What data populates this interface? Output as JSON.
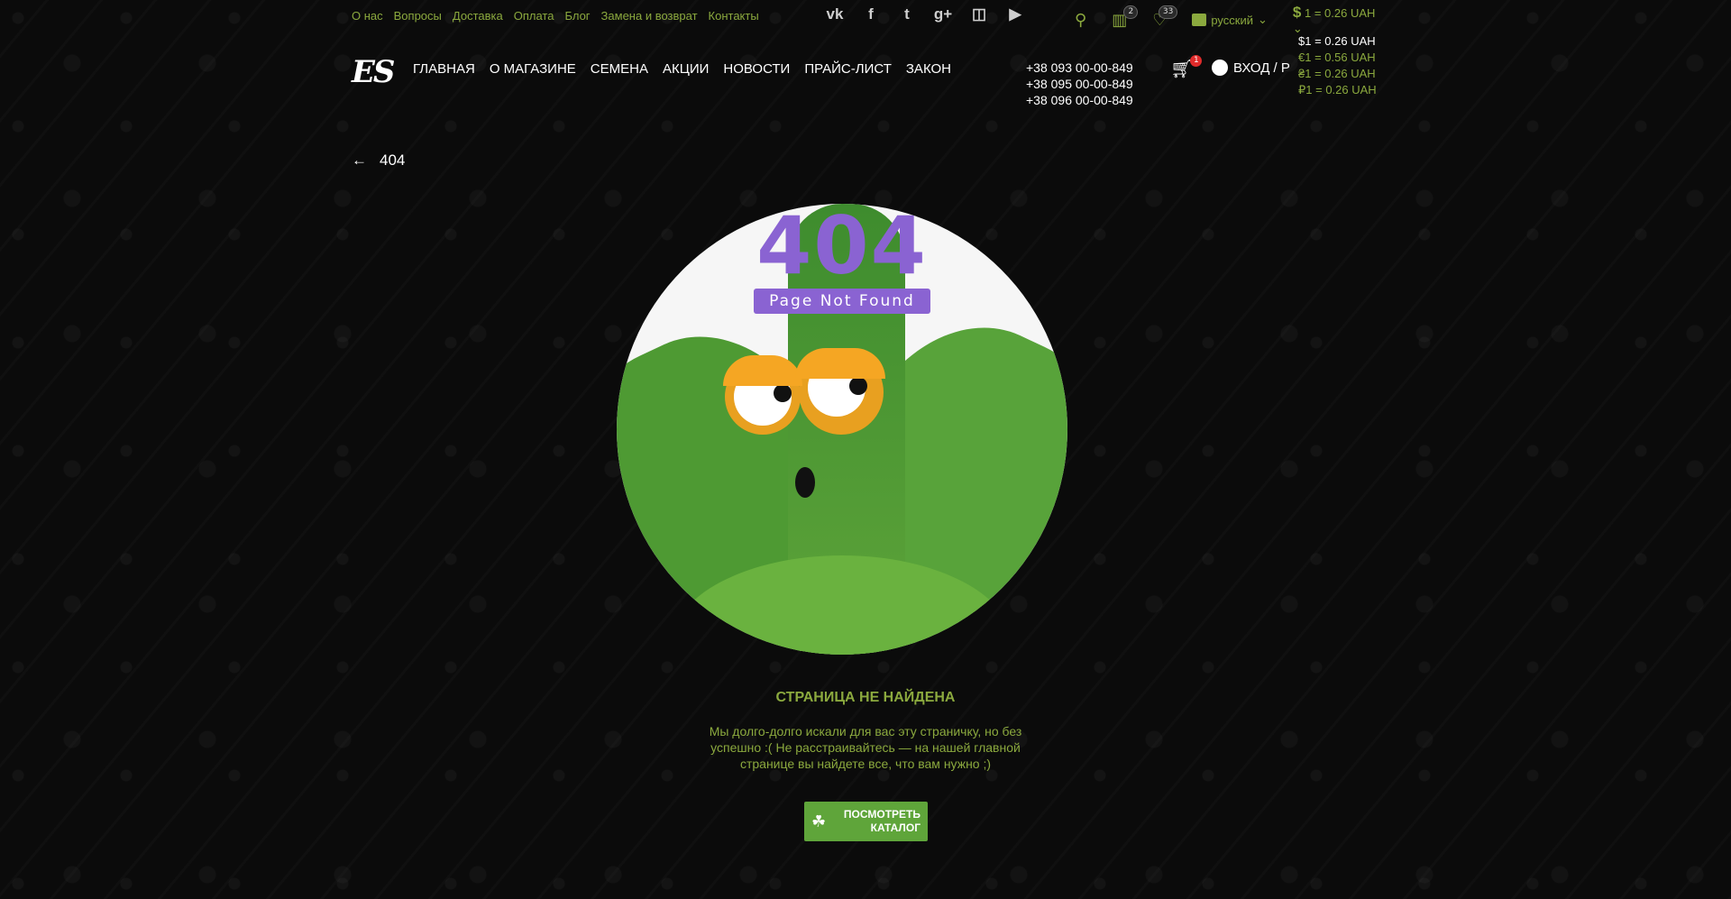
{
  "top_links": [
    "О нас",
    "Вопросы",
    "Доставка",
    "Оплата",
    "Блог",
    "Замена и возврат",
    "Контакты"
  ],
  "socials": [
    "vk-icon",
    "facebook-icon",
    "twitter-icon",
    "google-plus-icon",
    "instagram-icon",
    "youtube-icon"
  ],
  "topbar": {
    "compare_count": "2",
    "wishlist_count": "33",
    "language": "русский",
    "currency_symbol": "$",
    "currency_rate": "1 = 0.26 UAH"
  },
  "currency_options": [
    "$1 = 0.26 UAH",
    "€1 = 0.56 UAH",
    "₴1 = 0.26 UAH",
    "₽1 = 0.26 UAH"
  ],
  "logo": "ES",
  "nav": [
    "ГЛАВНАЯ",
    "О МАГАЗИНЕ",
    "СЕМЕНА",
    "АКЦИИ",
    "НОВОСТИ",
    "ПРАЙС-ЛИСТ",
    "ЗАКОН"
  ],
  "phones": [
    "+38 093 00-00-849",
    "+38 095 00-00-849",
    "+38 096 00-00-849"
  ],
  "cart_count": "1",
  "login_label": "ВХОД / Р",
  "breadcrumb": "404",
  "illustration": {
    "big": "404",
    "caption": "Page Not Found"
  },
  "message": {
    "title": "СТРАНИЦА НЕ НАЙДЕНА",
    "body": "Мы долго-долго искали для вас эту страничку, но без успешно :( Не расстраивайтесь — на нашей главной странице вы найдете все, что вам нужно ;)"
  },
  "cta": {
    "line1": "ПОСМОТРЕТЬ",
    "line2": "КАТАЛОГ"
  },
  "colors": {
    "accent": "#8ba93e",
    "purple": "#8a63d2",
    "green": "#5fa53a",
    "background": "#0b0b0b"
  }
}
